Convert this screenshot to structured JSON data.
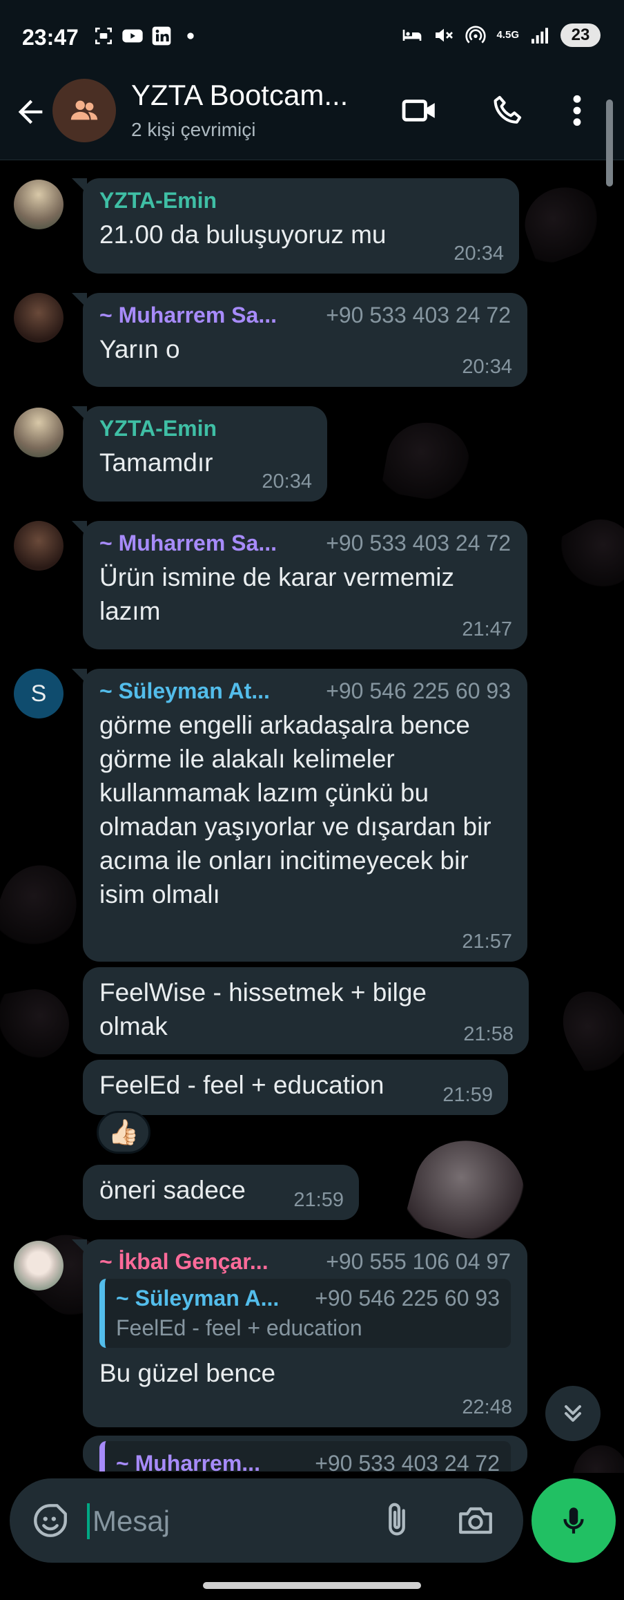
{
  "status_bar": {
    "time": "23:47",
    "left_icons": [
      "screenshot-icon",
      "youtube-icon",
      "linkedin-icon",
      "dot-icon"
    ],
    "right_icons": [
      "bed-icon",
      "mute-icon",
      "hotspot-icon",
      "4g-icon",
      "signal-icon"
    ],
    "network_label": "4.5G",
    "battery": "23"
  },
  "header": {
    "title": "YZTA Bootcam...",
    "subtitle": "2 kişi çevrimiçi"
  },
  "messages": [
    {
      "sender": "YZTA-Emin",
      "sender_color": "#3fbfa5",
      "phone": "",
      "text": "21.00 da buluşuyoruz mu",
      "time": "20:34"
    },
    {
      "sender": "~ Muharrem Sa...",
      "sender_color": "#a78bfa",
      "phone": "+90 533 403 24 72",
      "text": "Yarın o",
      "time": "20:34"
    },
    {
      "sender": "YZTA-Emin",
      "sender_color": "#3fbfa5",
      "phone": "",
      "text": "Tamamdır",
      "time": "20:34"
    },
    {
      "sender": "~ Muharrem Sa...",
      "sender_color": "#a78bfa",
      "phone": "+90 533 403 24 72",
      "text": "Ürün ismine de karar vermemiz lazım",
      "time": "21:47"
    },
    {
      "sender": "~ Süleyman At...",
      "sender_color": "#53bdeb",
      "phone": "+90 546 225 60 93",
      "avatar_letter": "S",
      "text": "görme engelli arkadaşalra bence görme ile alakalı kelimeler kullanmamak lazım çünkü bu olmadan yaşıyorlar ve dışardan bir acıma ile onları incitimeyecek bir isim olmalı",
      "time": "21:57"
    },
    {
      "text": "FeelWise - hissetmek + bilge olmak",
      "time": "21:58"
    },
    {
      "text": "FeelEd - feel + education",
      "time": "21:59",
      "reaction": "👍🏻"
    },
    {
      "text": "öneri sadece",
      "time": "21:59"
    },
    {
      "sender": "~ İkbal Gençar...",
      "sender_color": "#ff6b9a",
      "phone": "+90 555 106 04 97",
      "quote": {
        "sender": "~ Süleyman A...",
        "phone": "+90 546 225 60 93",
        "text": "FeelEd - feel + education"
      },
      "text": "Bu güzel bence",
      "time": "22:48"
    },
    {
      "quote": {
        "sender": "~ Muharrem...",
        "phone": "+90 533 403 24 72"
      }
    }
  ],
  "input": {
    "placeholder": "Mesaj"
  },
  "colors": {
    "background": "#000000",
    "bubble": "#202c33",
    "header": "#0b141a",
    "mic_button": "#21c063",
    "cursor": "#00a884"
  }
}
